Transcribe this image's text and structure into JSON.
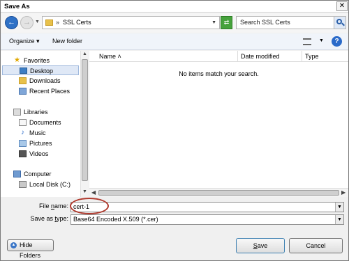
{
  "window": {
    "title": "Save As",
    "close": "✕"
  },
  "nav": {
    "back": "←",
    "forward": "→",
    "address_sep": "»",
    "address": "SSL Certs",
    "refresh": "⇄",
    "search_placeholder": "Search SSL Certs"
  },
  "toolbar": {
    "organize": "Organize",
    "new_folder": "New folder",
    "help": "?"
  },
  "sidebar": {
    "favorites": {
      "label": "Favorites",
      "items": [
        "Desktop",
        "Downloads",
        "Recent Places"
      ]
    },
    "libraries": {
      "label": "Libraries",
      "items": [
        "Documents",
        "Music",
        "Pictures",
        "Videos"
      ]
    },
    "computer": {
      "label": "Computer",
      "items": [
        "Local Disk (C:)"
      ]
    }
  },
  "filelist": {
    "columns": [
      "Name",
      "Date modified",
      "Type"
    ],
    "empty_message": "No items match your search."
  },
  "form": {
    "file_name_label_pre": "File ",
    "file_name_label_ul": "n",
    "file_name_label_post": "ame:",
    "file_name_value": "cert-1",
    "save_type_label_pre": "Save as ",
    "save_type_label_ul": "t",
    "save_type_label_post": "ype:",
    "save_type_value": "Base64 Encoded X.509 (*.cer)"
  },
  "buttons": {
    "hide_folders": "Hide Folders",
    "save_ul": "S",
    "save_rest": "ave",
    "cancel": "Cancel"
  },
  "colors": {
    "accent": "#2f71c6",
    "annotation": "#b03a2e",
    "selection": "#dfe8f6"
  }
}
